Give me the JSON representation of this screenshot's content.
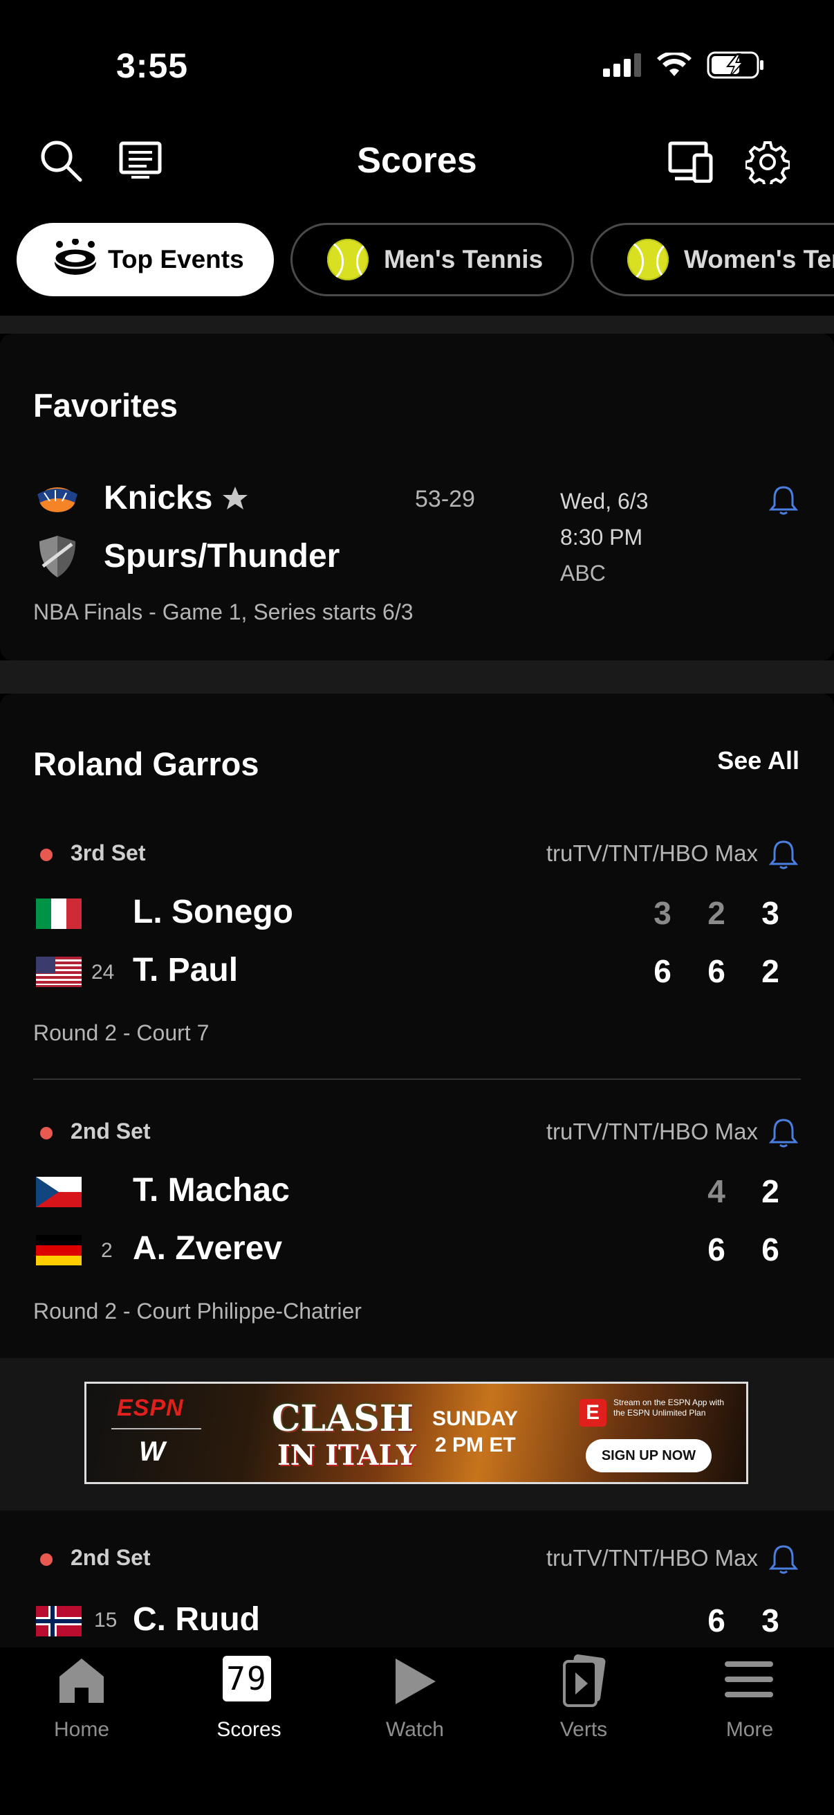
{
  "status_bar": {
    "time": "3:55"
  },
  "header": {
    "title": "Scores"
  },
  "chips": [
    {
      "label": "Top Events",
      "icon": "top-events-icon"
    },
    {
      "label": "Men's Tennis",
      "icon": "tennis-ball-icon"
    },
    {
      "label": "Women's Tennis",
      "icon": "tennis-ball-icon"
    }
  ],
  "favorites": {
    "title": "Favorites",
    "team1": "Knicks",
    "team1_record": "53-29",
    "team2": "Spurs/Thunder",
    "date": "Wed, 6/3",
    "time": "8:30 PM",
    "network": "ABC",
    "note": "NBA Finals - Game 1, Series starts 6/3"
  },
  "roland": {
    "title": "Roland Garros",
    "see_all": "See All",
    "matches": [
      {
        "status": "3rd Set",
        "broadcast": "truTV/TNT/HBO Max",
        "p1": {
          "name": "L. Sonego",
          "seed": "",
          "sets": [
            "3",
            "2",
            "3"
          ]
        },
        "p2": {
          "name": "T. Paul",
          "seed": "24",
          "sets": [
            "6",
            "6",
            "2"
          ]
        },
        "info": "Round 2 - Court 7"
      },
      {
        "status": "2nd Set",
        "broadcast": "truTV/TNT/HBO Max",
        "p1": {
          "name": "T. Machac",
          "seed": "",
          "sets": [
            "4",
            "2"
          ]
        },
        "p2": {
          "name": "A. Zverev",
          "seed": "2",
          "sets": [
            "6",
            "6"
          ]
        },
        "info": "Round 2 - Court Philippe-Chatrier"
      },
      {
        "status": "2nd Set",
        "broadcast": "truTV/TNT/HBO Max",
        "p1": {
          "name": "C. Ruud",
          "seed": "15",
          "sets": [
            "6",
            "3"
          ]
        }
      }
    ]
  },
  "ad": {
    "brand": "ESPN",
    "sub_brand": "W",
    "event_line1": "CLASH",
    "event_line2": "IN ITALY",
    "day": "SUNDAY",
    "time": "2 PM ET",
    "stream_text": "Stream on the ESPN App with the ESPN Unlimited Plan",
    "cta": "SIGN UP NOW"
  },
  "tabbar": {
    "home": "Home",
    "scores": "Scores",
    "scores_icon_text": "79",
    "watch": "Watch",
    "verts": "Verts",
    "more": "More"
  },
  "colors": {
    "accent_blue": "#4a7fe0",
    "live_red": "#e85a4f",
    "tennis_yellow": "#d9e021"
  }
}
